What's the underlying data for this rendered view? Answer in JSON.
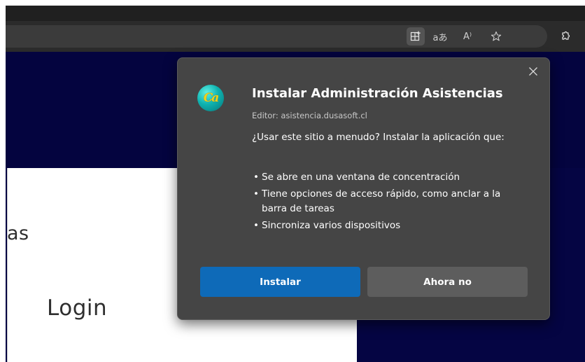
{
  "toolbar": {
    "icons": [
      "app-available-icon",
      "translate-icon",
      "read-aloud-icon",
      "favorites-star-icon",
      "extensions-icon"
    ],
    "translate_glyph": "aあ",
    "read_aloud_glyph": "A⁾"
  },
  "page": {
    "heading_fragment": "as",
    "login_heading": "Login"
  },
  "install_dialog": {
    "logo_text": "Ca",
    "title": "Instalar Administración Asistencias",
    "publisher": "Editor: asistencia.dusasoft.cl",
    "question": "¿Usar este sitio a menudo? Instalar la aplicación que:",
    "features": [
      "Se abre en una ventana de concentración",
      "Tiene opciones de acceso rápido, como anclar a la barra de tareas",
      "Sincroniza varios dispositivos"
    ],
    "install_label": "Instalar",
    "dismiss_label": "Ahora no"
  },
  "colors": {
    "dialog_bg": "#454545",
    "primary_button": "#0e6ab8",
    "secondary_button": "#5d5d5d",
    "page_navy": "#04043f"
  }
}
